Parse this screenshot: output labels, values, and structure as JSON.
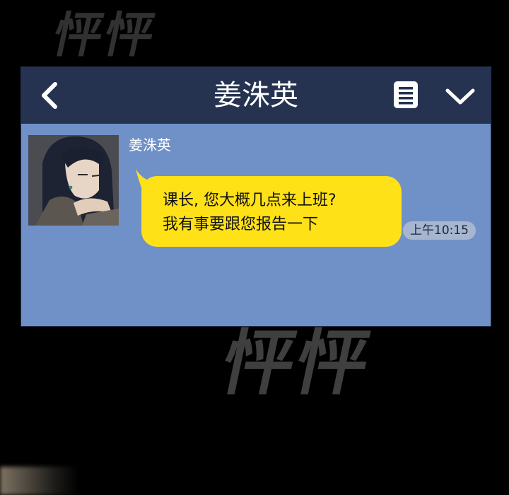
{
  "watermark": {
    "text_top": "怦怦",
    "text_mid": "怦怦"
  },
  "header": {
    "title": "姜洙英",
    "back_icon": "chevron-left-icon",
    "menu_icon": "menu-list-icon",
    "expand_icon": "chevron-down-icon",
    "bg_color": "#253250"
  },
  "chat": {
    "bg_color": "#6f91c8",
    "messages": [
      {
        "sender": "姜洙英",
        "lines": [
          "课长, 您大概几点来上班?",
          "我有事要跟您报告一下"
        ],
        "time": "上午10:15",
        "bubble_color": "#ffe118"
      }
    ]
  }
}
